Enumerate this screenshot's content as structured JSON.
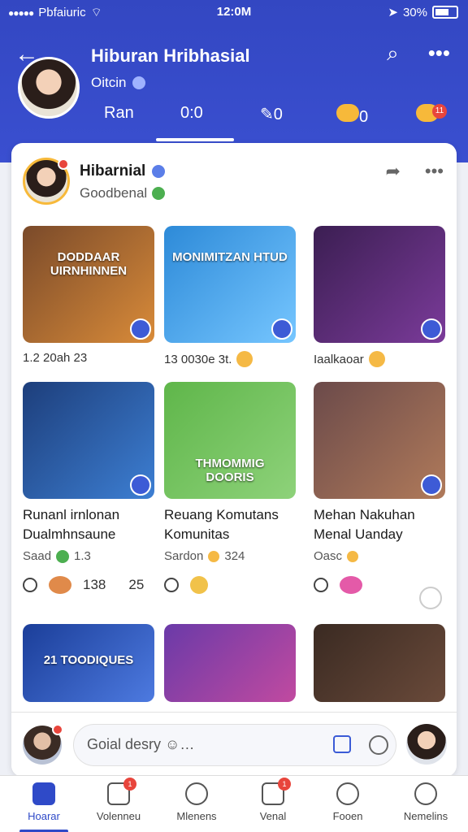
{
  "status": {
    "carrier": "Pbfaiuric",
    "time": "12:0M",
    "battery": "30%"
  },
  "header": {
    "title": "Hiburan Hribhasial",
    "subtitle": "Oitcin",
    "tabs": [
      "Ran",
      "0:0",
      "0",
      "0"
    ],
    "tab_badge": "11"
  },
  "post": {
    "author": "Hibarnial",
    "meta": "Goodbenal"
  },
  "tiles": [
    {
      "thumb_title": "DODDAAR UIRNHINNEN",
      "meta": "1.2 20ah 23",
      "colors": [
        "#7a4a2a",
        "#d98b39"
      ]
    },
    {
      "thumb_title": "MONIMITZAN HTUD",
      "meta": "13 0030e 3t.",
      "colors": [
        "#2d8ad8",
        "#76c6ff"
      ]
    },
    {
      "thumb_title": "",
      "meta": "Iaalkaoar",
      "colors": [
        "#3b1e52",
        "#7b3b9a"
      ]
    },
    {
      "thumb_title": "",
      "name": "Runanl irnlonan Dualmhnsaune",
      "small": "Saad",
      "small2": "1.3",
      "likes": "138",
      "comments": "25",
      "colors": [
        "#1d3e7b",
        "#3d7fd3"
      ]
    },
    {
      "thumb_title": "THMOMMIG DOORIS",
      "name": "Reuang Komutans Komunitas",
      "small": "Sardon",
      "small2": "324",
      "colors": [
        "#5fb64a",
        "#8ed27a"
      ]
    },
    {
      "thumb_title": "",
      "name": "Mehan Nakuhan Menal Uanday",
      "small": "Oasc",
      "colors": [
        "#6b4a4a",
        "#b07a5a"
      ]
    },
    {
      "thumb_title": "21 TOODIQUES",
      "colors": [
        "#1b3e99",
        "#4d7ae0"
      ]
    },
    {
      "thumb_title": "",
      "colors": [
        "#6a3aa8",
        "#c14aa0"
      ]
    },
    {
      "thumb_title": "",
      "colors": [
        "#3a2a22",
        "#6a4a3a"
      ]
    }
  ],
  "composer": {
    "placeholder": "Goial desry"
  },
  "nav": [
    {
      "label": "Hoarar",
      "active": true
    },
    {
      "label": "Volenneu",
      "badge": "1"
    },
    {
      "label": "Mlenens"
    },
    {
      "label": "Venal",
      "badge": "1"
    },
    {
      "label": "Fooen"
    },
    {
      "label": "Nemelins"
    }
  ]
}
